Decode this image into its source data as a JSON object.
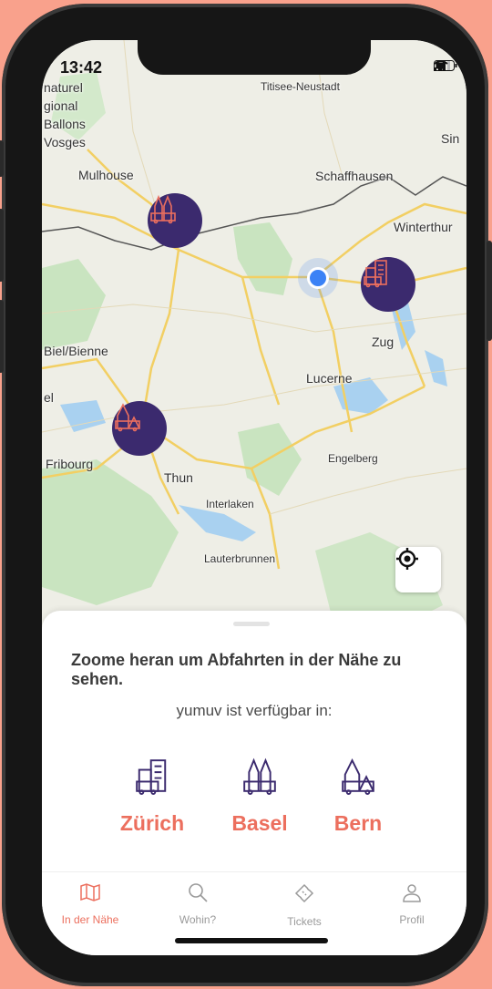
{
  "status": {
    "time": "13:42"
  },
  "map": {
    "labels": {
      "titisee": "Titisee-Neustadt",
      "naturel": "naturel",
      "gional": "gional",
      "ballons": "Ballons",
      "vosges": "Vosges",
      "mulhouse": "Mulhouse",
      "schaffhausen": "Schaffhausen",
      "sin": "Sin",
      "winterthur": "Winterthur",
      "zug": "Zug",
      "biel": "Biel/Bienne",
      "lucerne": "Lucerne",
      "el": "el",
      "fribourg": "Fribourg",
      "thun": "Thun",
      "engelberg": "Engelberg",
      "interlaken": "Interlaken",
      "lauterbrunnen": "Lauterbrunnen"
    }
  },
  "sheet": {
    "title": "Zoome heran um Abfahrten in der Nähe zu sehen.",
    "subtitle": "yumuv ist verfügbar in:",
    "cities": [
      {
        "name": "Zürich",
        "icon": "zurich-city-icon"
      },
      {
        "name": "Basel",
        "icon": "basel-city-icon"
      },
      {
        "name": "Bern",
        "icon": "bern-city-icon"
      }
    ]
  },
  "tabs": [
    {
      "label": "In der Nähe",
      "icon": "map-icon",
      "active": true
    },
    {
      "label": "Wohin?",
      "icon": "search-icon",
      "active": false
    },
    {
      "label": "Tickets",
      "icon": "ticket-icon",
      "active": false
    },
    {
      "label": "Profil",
      "icon": "profile-icon",
      "active": false
    }
  ],
  "colors": {
    "accent": "#ec6f5e",
    "pin": "#3b2a6e",
    "background": "#f9a18c",
    "location": "#3b82f6"
  }
}
